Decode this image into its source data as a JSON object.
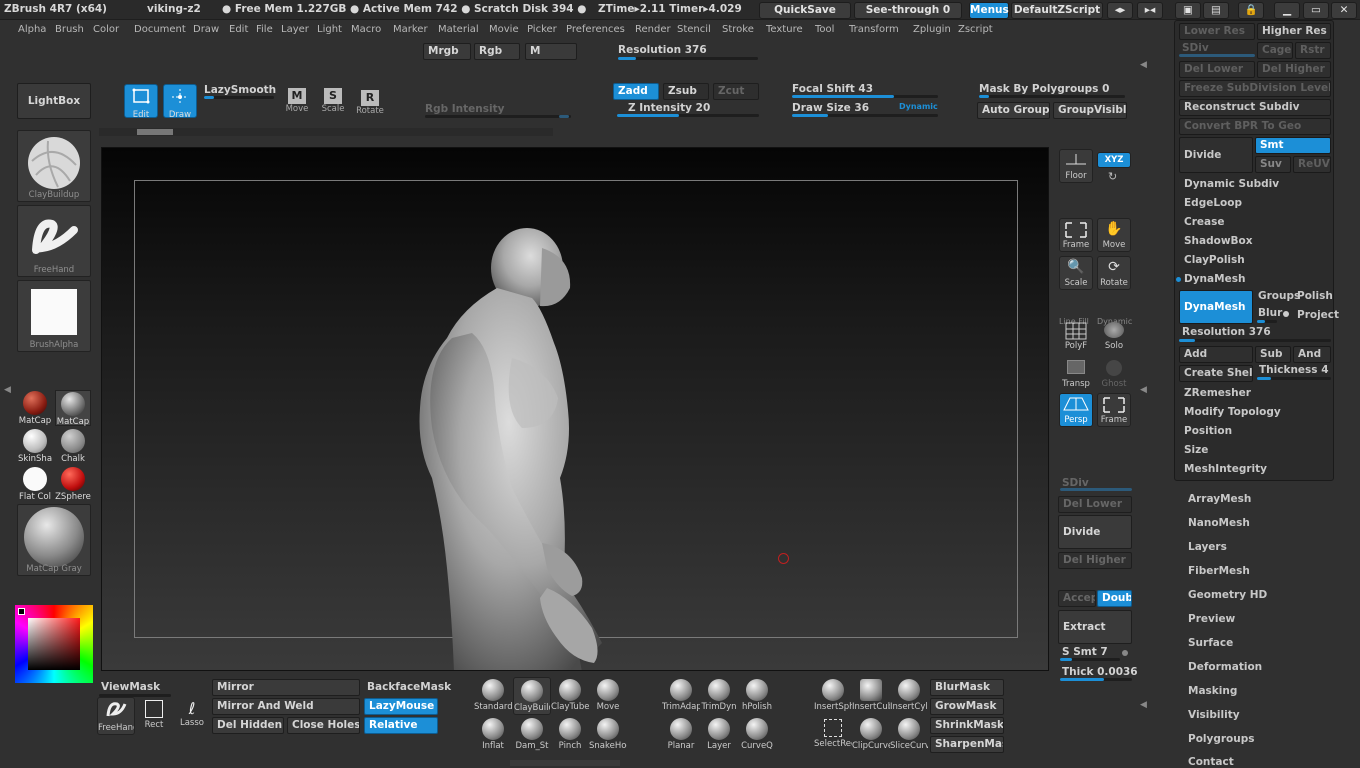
{
  "titlebar": {
    "app": "ZBrush 4R7 (x64)",
    "doc": "viking-z2",
    "freemem": "● Free Mem 1.227GB ● Active Mem 742 ● Scratch Disk 394 ●",
    "ztime": "ZTime▸2.11  Timer▸4.029",
    "quicksave": "QuickSave",
    "seethrough": "See-through   0",
    "menus": "Menus",
    "script": "DefaultZScript"
  },
  "menu": [
    "Alpha",
    "Brush",
    "Color",
    "Document",
    "Draw",
    "Edit",
    "File",
    "Layer",
    "Light",
    "Macro",
    "Marker",
    "Material",
    "Movie",
    "Picker",
    "Preferences",
    "Render",
    "Stencil",
    "Stroke",
    "Texture",
    "Tool",
    "Transform",
    "Zplugin",
    "Zscript"
  ],
  "topbar": {
    "mrgb": "Mrgb",
    "rgb": "Rgb",
    "m": "M",
    "resolution": "Resolution 376",
    "lightbox": "LightBox",
    "edit": "Edit",
    "draw": "Draw",
    "lazysmooth": "LazySmooth",
    "move": "Move",
    "scale": "Scale",
    "rotate": "Rotate",
    "rgb_intensity": "Rgb  Intensity",
    "zadd": "Zadd",
    "zsub": "Zsub",
    "zcut": "Zcut",
    "z_intensity": "Z  Intensity 20",
    "focal_shift": "Focal Shift 43",
    "draw_size": "Draw Size 36",
    "dynamic": "Dynamic",
    "mask_by_polygroups": "Mask By Polygroups 0",
    "auto_groups": "Auto Groups",
    "group_visible": "GroupVisible"
  },
  "leftshelf": {
    "brush1": "ClayBuildup",
    "brush2": "FreeHand",
    "brush3": "BrushAlpha",
    "mats": [
      "MatCap",
      "MatCap",
      "SkinSha",
      "Chalk",
      "Flat Col",
      "ZSphere"
    ],
    "matbig": "MatCap Gray"
  },
  "rightshelf": {
    "floor": "Floor",
    "xyz": "XYZ",
    "frame": "Frame",
    "move": "Move",
    "scale": "Scale",
    "rotate": "Rotate",
    "polyf": "PolyF",
    "solo": "Solo",
    "transp": "Transp",
    "ghost": "Ghost",
    "persp": "Persp",
    "frame2": "Frame",
    "line_fill": "Line Fill",
    "dynamic_label": "Dynamic",
    "sdiv": "SDiv",
    "del_lower": "Del Lower",
    "divide": "Divide",
    "del_higher": "Del Higher",
    "accept": "Accept",
    "double": "Double",
    "extract": "Extract",
    "s_smt": "S Smt 7",
    "thick": "Thick 0.0036"
  },
  "palette": {
    "lower_res": "Lower Res",
    "higher_res": "Higher Res",
    "sdiv": "SDiv",
    "cage": "Cage",
    "rstr": "Rstr",
    "del_lower": "Del Lower",
    "del_higher": "Del Higher",
    "freeze": "Freeze SubDivision Levels",
    "reconstruct": "Reconstruct Subdiv",
    "convert_bpr": "Convert BPR To Geo",
    "divide": "Divide",
    "smt": "Smt",
    "suv": "Suv",
    "reuv": "ReUV",
    "dynamic_subdiv": "Dynamic Subdiv",
    "edgeloop": "EdgeLoop",
    "crease": "Crease",
    "shadowbox": "ShadowBox",
    "claypolish": "ClayPolish",
    "dynamesh_title": "DynaMesh",
    "dynamesh_btn": "DynaMesh",
    "groups": "Groups",
    "polish": "Polish",
    "blur": "Blur",
    "project": "Project",
    "resolution": "Resolution 376",
    "add": "Add",
    "sub": "Sub",
    "and": "And",
    "create_shell": "Create Shell",
    "thickness": "Thickness 4",
    "zremesher": "ZRemesher",
    "modify_topology": "Modify Topology",
    "position": "Position",
    "size": "Size",
    "meshintegrity": "MeshIntegrity"
  },
  "subpalettes": [
    "ArrayMesh",
    "NanoMesh",
    "Layers",
    "FiberMesh",
    "Geometry HD",
    "Preview",
    "Surface",
    "Deformation",
    "Masking",
    "Visibility",
    "Polygroups",
    "Contact"
  ],
  "bottom": {
    "viewmask": "ViewMask",
    "mirror": "Mirror",
    "mirror_weld": "Mirror And Weld",
    "del_hidden": "Del Hidden",
    "close_holes": "Close Holes",
    "backface": "BackfaceMask",
    "lazymouse": "LazyMouse",
    "relative": "Relative",
    "freehand": "FreeHand",
    "rect": "Rect",
    "lasso": "Lasso",
    "brushes_row1": [
      "Standard",
      "ClayBuildup",
      "ClayTubes",
      "Move"
    ],
    "brushes_row2": [
      "Inflat",
      "Dam_St",
      "Pinch",
      "SnakeHook"
    ],
    "brushes_row3": [
      "TrimAdapt",
      "TrimDyn",
      "hPolish"
    ],
    "brushes_row4": [
      "Planar",
      "Layer",
      "CurveQ"
    ],
    "brushes_row5": [
      "InsertSphere",
      "InsertCube",
      "InsertCylinder"
    ],
    "brushes_row6": [
      "SelectRect",
      "ClipCurve",
      "SliceCurve"
    ],
    "masks": [
      "BlurMask",
      "GrowMask",
      "ShrinkMask",
      "SharpenMask"
    ]
  }
}
